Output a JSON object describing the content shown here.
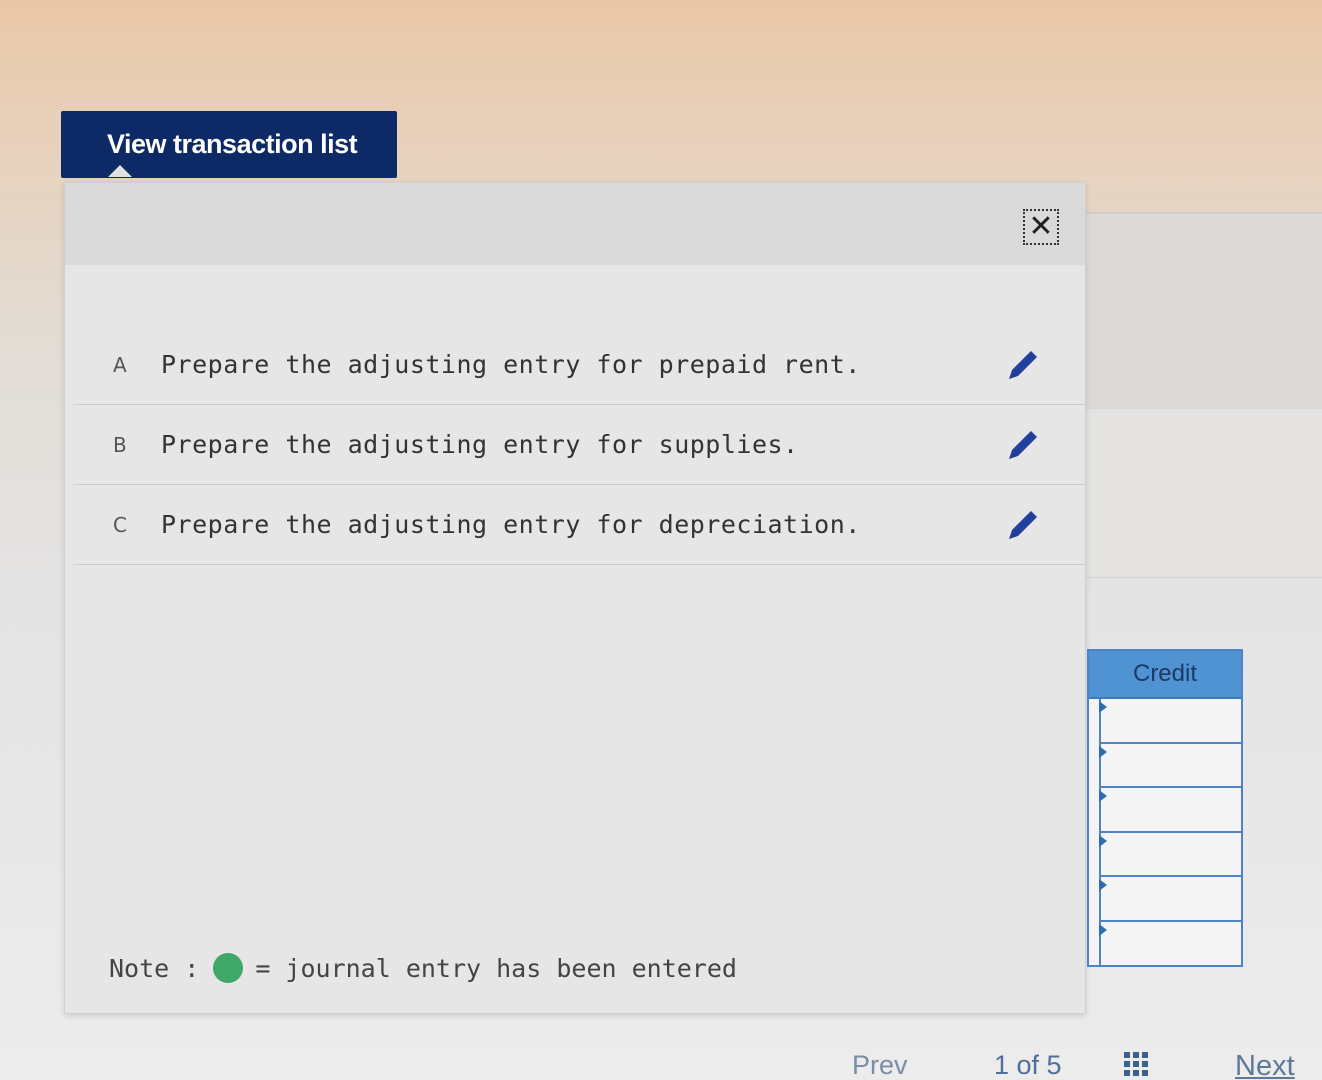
{
  "toolbar": {
    "view_button_label": "View transaction list"
  },
  "popup": {
    "close_symbol": "✕",
    "transactions": [
      {
        "letter": "A",
        "text": "Prepare the adjusting entry for prepaid rent."
      },
      {
        "letter": "B",
        "text": "Prepare the adjusting entry for supplies."
      },
      {
        "letter": "C",
        "text": "Prepare the adjusting entry for depreciation."
      }
    ],
    "note": {
      "prefix": "Note :",
      "text": "= journal entry has been entered",
      "dot_color": "#3fa868"
    }
  },
  "journal": {
    "credit_header": "Credit",
    "rows": 6
  },
  "pager": {
    "prev_label": "Prev",
    "page_indicator": "1 of 5",
    "next_label": "Next"
  },
  "colors": {
    "button_bg": "#0d2a66",
    "edit_icon": "#1f3f9a",
    "table_blue": "#4f93d3"
  },
  "icons": {
    "close": "close-icon",
    "edit": "pencil-icon",
    "grid": "grid-icon"
  }
}
